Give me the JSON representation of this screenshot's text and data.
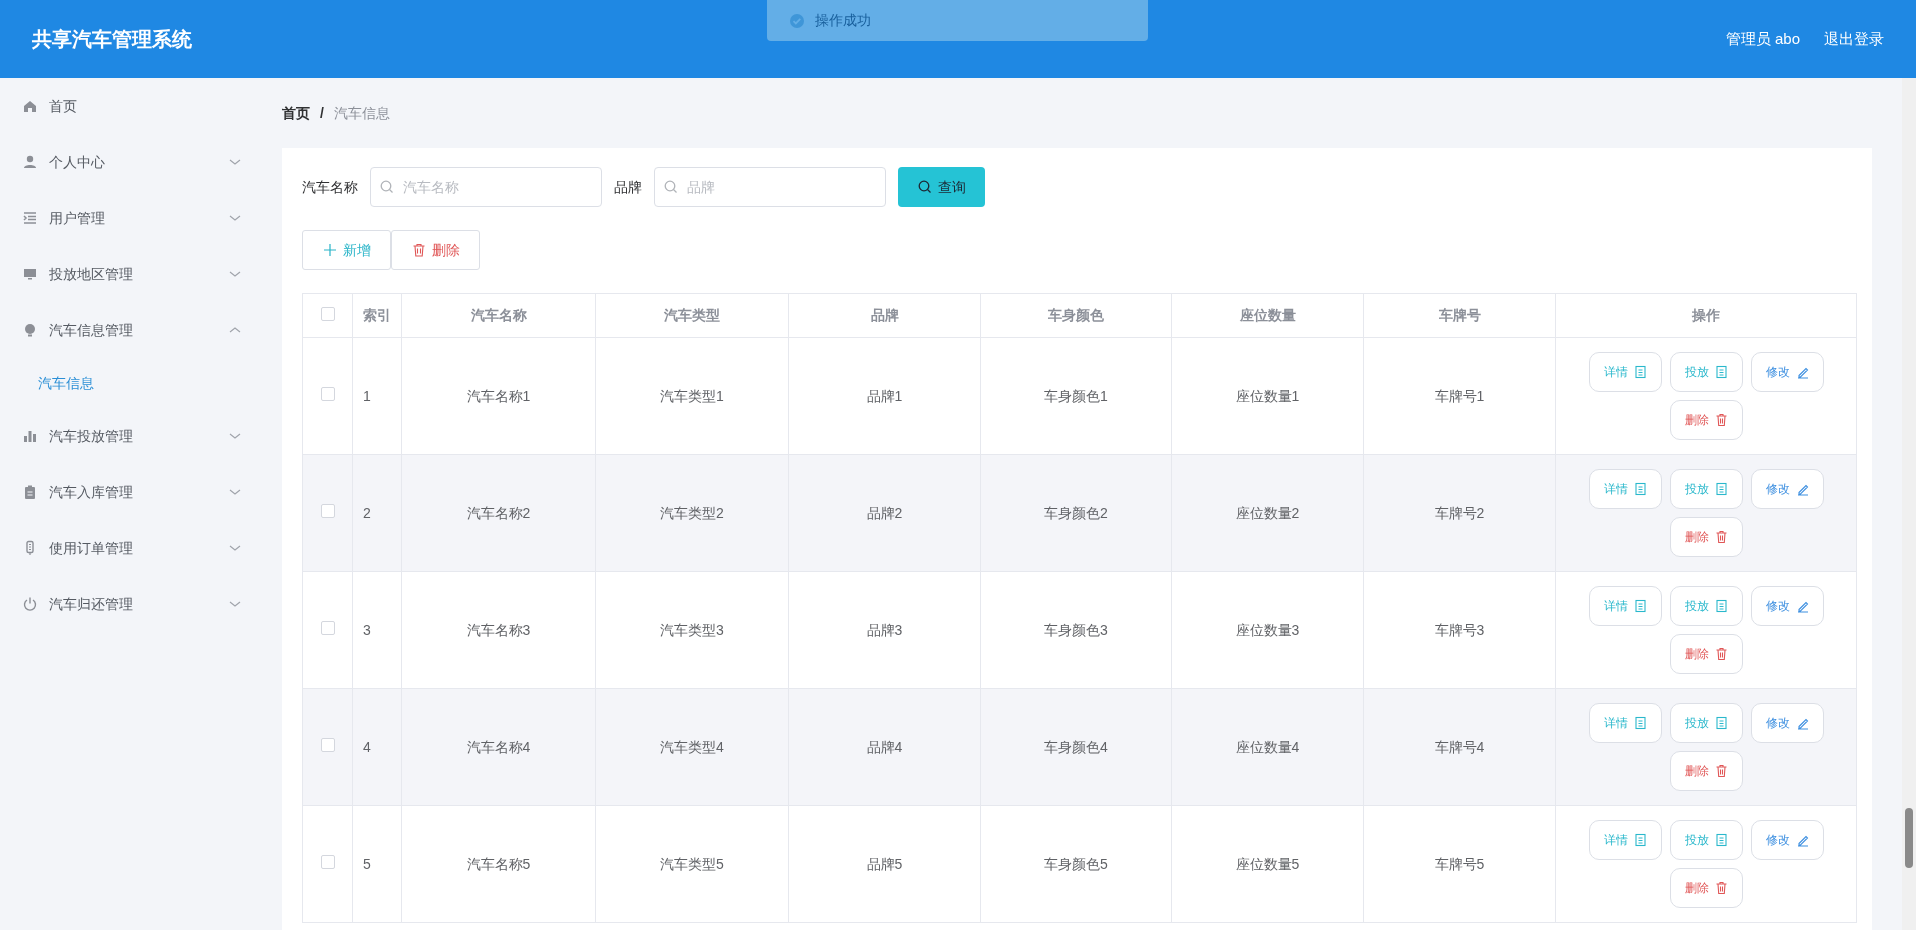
{
  "header": {
    "title": "共享汽车管理系统",
    "user": "管理员 abo",
    "logout": "退出登录"
  },
  "toast": {
    "text": "操作成功"
  },
  "sidebar": {
    "items": [
      {
        "label": "首页",
        "selected": false
      },
      {
        "label": "个人中心",
        "selected": false,
        "expanded": false
      },
      {
        "label": "用户管理",
        "selected": false,
        "expanded": false
      },
      {
        "label": "投放地区管理",
        "selected": false,
        "expanded": false
      },
      {
        "label": "汽车信息管理",
        "selected": false,
        "expanded": true,
        "children": [
          {
            "label": "汽车信息",
            "selected": true
          }
        ]
      },
      {
        "label": "汽车投放管理",
        "selected": false,
        "expanded": false
      },
      {
        "label": "汽车入库管理",
        "selected": false,
        "expanded": false
      },
      {
        "label": "使用订单管理",
        "selected": false,
        "expanded": false
      },
      {
        "label": "汽车归还管理",
        "selected": false,
        "expanded": false
      }
    ]
  },
  "breadcrumb": {
    "items": [
      "首页",
      "汽车信息"
    ],
    "separator": "/"
  },
  "search": {
    "fields": [
      {
        "label": "汽车名称",
        "placeholder": "汽车名称"
      },
      {
        "label": "品牌",
        "placeholder": "品牌"
      }
    ],
    "button": "查询"
  },
  "actions": [
    {
      "kind": "add",
      "label": "新增"
    },
    {
      "kind": "delete",
      "label": "删除"
    }
  ],
  "table": {
    "all_checked": false,
    "columns": [
      "索引",
      "汽车名称",
      "汽车类型",
      "品牌",
      "车身颜色",
      "座位数量",
      "车牌号",
      "操作"
    ],
    "rows": [
      {
        "checked": false,
        "cells": [
          "1",
          "汽车名称1",
          "汽车类型1",
          "品牌1",
          "车身颜色1",
          "座位数量1",
          "车牌号1"
        ],
        "actions": [
          {
            "kind": "detail",
            "label": "详情"
          },
          {
            "kind": "deploy",
            "label": "投放"
          },
          {
            "kind": "edit",
            "label": "修改"
          },
          {
            "kind": "delete",
            "label": "删除"
          }
        ]
      },
      {
        "checked": false,
        "cells": [
          "2",
          "汽车名称2",
          "汽车类型2",
          "品牌2",
          "车身颜色2",
          "座位数量2",
          "车牌号2"
        ],
        "actions": [
          {
            "kind": "detail",
            "label": "详情"
          },
          {
            "kind": "deploy",
            "label": "投放"
          },
          {
            "kind": "edit",
            "label": "修改"
          },
          {
            "kind": "delete",
            "label": "删除"
          }
        ]
      },
      {
        "checked": false,
        "cells": [
          "3",
          "汽车名称3",
          "汽车类型3",
          "品牌3",
          "车身颜色3",
          "座位数量3",
          "车牌号3"
        ],
        "actions": [
          {
            "kind": "detail",
            "label": "详情"
          },
          {
            "kind": "deploy",
            "label": "投放"
          },
          {
            "kind": "edit",
            "label": "修改"
          },
          {
            "kind": "delete",
            "label": "删除"
          }
        ]
      },
      {
        "checked": false,
        "cells": [
          "4",
          "汽车名称4",
          "汽车类型4",
          "品牌4",
          "车身颜色4",
          "座位数量4",
          "车牌号4"
        ],
        "actions": [
          {
            "kind": "detail",
            "label": "详情"
          },
          {
            "kind": "deploy",
            "label": "投放"
          },
          {
            "kind": "edit",
            "label": "修改"
          },
          {
            "kind": "delete",
            "label": "删除"
          }
        ]
      },
      {
        "checked": false,
        "cells": [
          "5",
          "汽车名称5",
          "汽车类型5",
          "品牌5",
          "车身颜色5",
          "座位数量5",
          "车牌号5"
        ],
        "actions": [
          {
            "kind": "detail",
            "label": "详情"
          },
          {
            "kind": "deploy",
            "label": "投放"
          },
          {
            "kind": "edit",
            "label": "修改"
          },
          {
            "kind": "delete",
            "label": "删除"
          }
        ]
      }
    ]
  }
}
